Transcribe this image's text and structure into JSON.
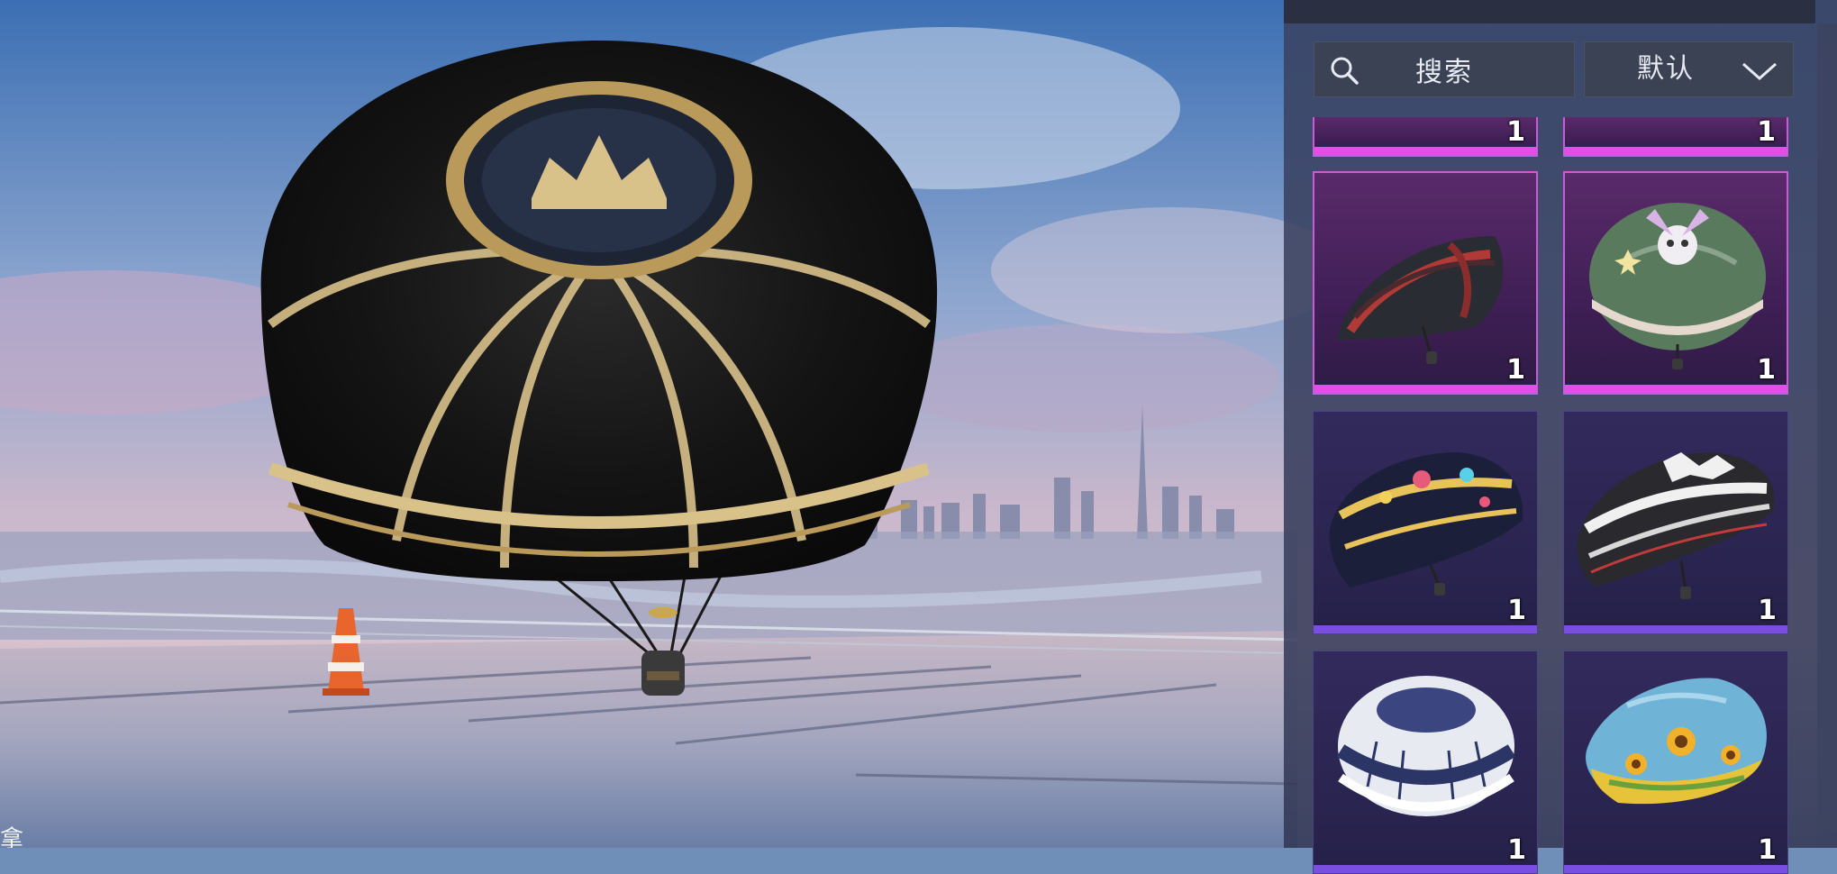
{
  "search": {
    "label": "搜索",
    "icon": "search-icon"
  },
  "sort": {
    "label": "默认",
    "icon": "chevron-down-icon"
  },
  "inventory": {
    "items": [
      {
        "name": "partial-top-left",
        "count": "1",
        "rarity": "pink"
      },
      {
        "name": "partial-top-right",
        "count": "1",
        "rarity": "pink"
      },
      {
        "name": "red-black-parachute",
        "count": "1",
        "rarity": "pink"
      },
      {
        "name": "green-skull-wings-parachute",
        "count": "1",
        "rarity": "pink"
      },
      {
        "name": "colorful-party-parachute",
        "count": "1",
        "rarity": "purple"
      },
      {
        "name": "black-white-parachute",
        "count": "1",
        "rarity": "purple"
      },
      {
        "name": "white-navy-parachute",
        "count": "1",
        "rarity": "purple"
      },
      {
        "name": "sunflower-parachute",
        "count": "1",
        "rarity": "purple"
      }
    ]
  },
  "colors": {
    "pink_bar": "#e44de8",
    "purple_bar": "#7a4ee0",
    "panel_bg": "#3a4260"
  }
}
